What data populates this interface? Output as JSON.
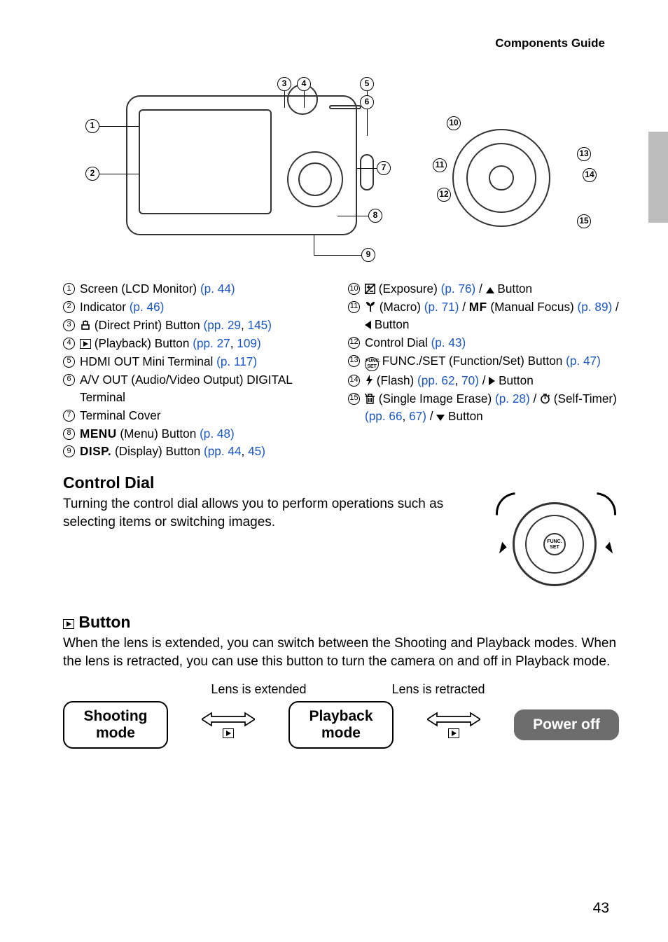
{
  "header": {
    "title": "Components Guide"
  },
  "page_number": "43",
  "callout_numbers": [
    "1",
    "2",
    "3",
    "4",
    "5",
    "6",
    "7",
    "8",
    "9",
    "10",
    "11",
    "12",
    "13",
    "14",
    "15"
  ],
  "left_items": [
    {
      "n": "1",
      "parts": [
        {
          "t": "Screen (LCD Monitor) "
        },
        {
          "t": "(p. 44)",
          "link": true
        }
      ]
    },
    {
      "n": "2",
      "parts": [
        {
          "t": "Indicator "
        },
        {
          "t": "(p. 46)",
          "link": true
        }
      ]
    },
    {
      "n": "3",
      "parts": [
        {
          "icon": "print"
        },
        {
          "t": " (Direct Print) Button "
        },
        {
          "t": "(pp. 29",
          "link": true
        },
        {
          "t": ", "
        },
        {
          "t": "145",
          "link": true
        },
        {
          "t": ")",
          "link": true
        }
      ]
    },
    {
      "n": "4",
      "parts": [
        {
          "icon": "playback-box"
        },
        {
          "t": " (Playback) Button "
        },
        {
          "t": "(pp. 27",
          "link": true
        },
        {
          "t": ", "
        },
        {
          "t": "109",
          "link": true
        },
        {
          "t": ")",
          "link": true
        }
      ]
    },
    {
      "n": "5",
      "parts": [
        {
          "t": "HDMI OUT Mini Terminal "
        },
        {
          "t": "(p. 117)",
          "link": true
        }
      ]
    },
    {
      "n": "6",
      "parts": [
        {
          "t": "A/V OUT (Audio/Video Output) DIGITAL Terminal"
        }
      ],
      "wrap_indent": true
    },
    {
      "n": "7",
      "parts": [
        {
          "t": "Terminal Cover"
        }
      ]
    },
    {
      "n": "8",
      "parts": [
        {
          "icon": "menu-word"
        },
        {
          "t": " (Menu) Button "
        },
        {
          "t": "(p. 48)",
          "link": true
        }
      ]
    },
    {
      "n": "9",
      "parts": [
        {
          "icon": "disp-word"
        },
        {
          "t": " (Display) Button "
        },
        {
          "t": "(pp. 44",
          "link": true
        },
        {
          "t": ", "
        },
        {
          "t": "45",
          "link": true
        },
        {
          "t": ")",
          "link": true
        }
      ]
    }
  ],
  "right_items": [
    {
      "n": "10",
      "parts": [
        {
          "icon": "exposure"
        },
        {
          "t": " (Exposure) "
        },
        {
          "t": "(p. 76)",
          "link": true
        },
        {
          "t": " / "
        },
        {
          "icon": "up"
        },
        {
          "t": " Button"
        }
      ]
    },
    {
      "n": "11",
      "parts": [
        {
          "icon": "macro"
        },
        {
          "t": " (Macro) "
        },
        {
          "t": "(p. 71)",
          "link": true
        },
        {
          "t": " / "
        },
        {
          "icon": "mf-word"
        },
        {
          "t": " (Manual Focus) "
        },
        {
          "t": "(p. 89)",
          "link": true
        },
        {
          "t": " / "
        },
        {
          "icon": "left"
        },
        {
          "t": " Button"
        }
      ],
      "wrap_indent": true
    },
    {
      "n": "12",
      "parts": [
        {
          "t": "Control Dial "
        },
        {
          "t": "(p. 43)",
          "link": true
        }
      ]
    },
    {
      "n": "13",
      "parts": [
        {
          "icon": "funcset"
        },
        {
          "t": " FUNC./SET (Function/Set) Button "
        },
        {
          "t": "(p. 47)",
          "link": true
        }
      ],
      "wrap_indent": true
    },
    {
      "n": "14",
      "parts": [
        {
          "icon": "flash"
        },
        {
          "t": " (Flash) "
        },
        {
          "t": "(pp. 62",
          "link": true
        },
        {
          "t": ", "
        },
        {
          "t": "70",
          "link": true
        },
        {
          "t": ")",
          "link": true
        },
        {
          "t": " / "
        },
        {
          "icon": "right"
        },
        {
          "t": " Button"
        }
      ]
    },
    {
      "n": "15",
      "parts": [
        {
          "icon": "erase"
        },
        {
          "t": " (Single Image Erase) "
        },
        {
          "t": "(p. 28)",
          "link": true
        },
        {
          "t": " / "
        },
        {
          "icon": "timer"
        },
        {
          "t": " (Self-Timer) "
        },
        {
          "t": "(pp. 66",
          "link": true
        },
        {
          "t": ", "
        },
        {
          "t": "67",
          "link": true
        },
        {
          "t": ")",
          "link": true
        },
        {
          "t": " / "
        },
        {
          "icon": "down"
        },
        {
          "t": " Button"
        }
      ],
      "wrap_indent": true
    }
  ],
  "control_dial": {
    "heading": "Control Dial",
    "text": "Turning the control dial allows you to perform operations such as selecting items or switching images."
  },
  "playback_button": {
    "heading_suffix": " Button",
    "text": "When the lens is extended, you can switch between the Shooting and Playback modes. When the lens is retracted, you can use this button to turn the camera on and off in Playback mode."
  },
  "mode_diagram": {
    "label_extended": "Lens is extended",
    "label_retracted": "Lens is retracted",
    "box_shooting": "Shooting mode",
    "box_playback": "Playback mode",
    "box_poweroff": "Power off"
  }
}
